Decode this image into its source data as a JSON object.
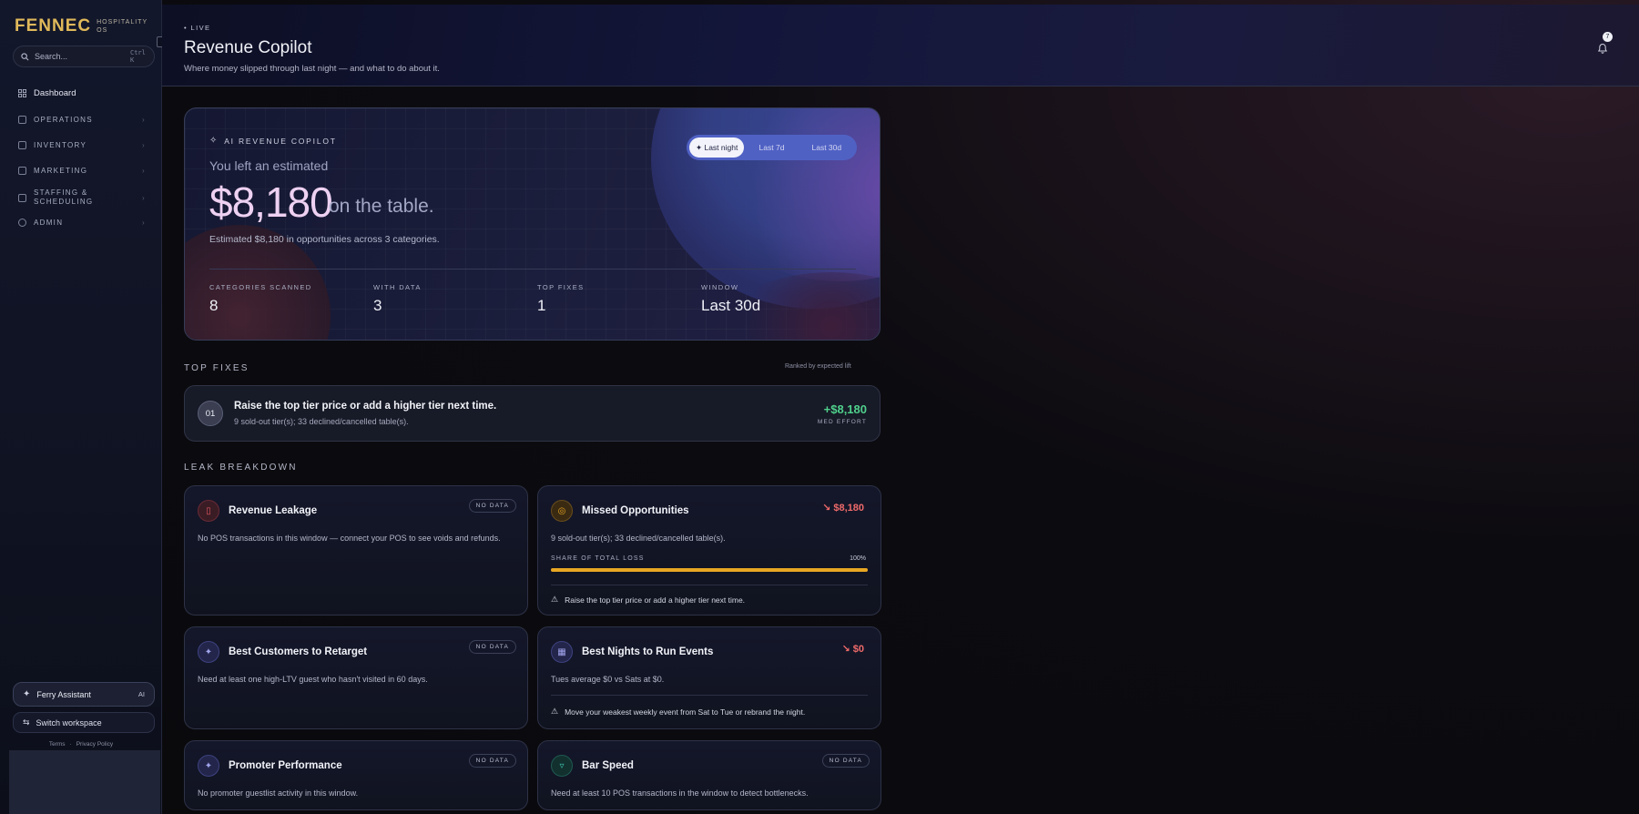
{
  "sidebar": {
    "logo": "FENNEC",
    "logo_sub_1": "HOSPITALITY",
    "logo_sub_2": "OS",
    "search_placeholder": "Search...",
    "search_shortcut": "Ctrl K",
    "items": [
      {
        "label": "Dashboard"
      },
      {
        "label": "OPERATIONS"
      },
      {
        "label": "INVENTORY"
      },
      {
        "label": "MARKETING"
      },
      {
        "label": "STAFFING & SCHEDULING"
      },
      {
        "label": "ADMIN"
      }
    ],
    "assistant_label": "Ferry Assistant",
    "assistant_tag": "AI",
    "switch_label": "Switch workspace",
    "terms": "Terms",
    "privacy": "Privacy Policy"
  },
  "header": {
    "live": "LIVE",
    "title": "Revenue Copilot",
    "subtitle": "Where money slipped through last night — and what to do about it.",
    "notifications": "7"
  },
  "hero": {
    "tag": "AI REVENUE COPILOT",
    "intro": "You left an estimated",
    "amount": "$8,180",
    "on_table": "on the table.",
    "description": "Estimated $8,180 in opportunities across 3 categories.",
    "tabs": [
      {
        "label": "Last night",
        "active": true
      },
      {
        "label": "Last 7d",
        "active": false
      },
      {
        "label": "Last 30d",
        "active": false
      }
    ],
    "stats": [
      {
        "label": "CATEGORIES SCANNED",
        "value": "8"
      },
      {
        "label": "WITH DATA",
        "value": "3"
      },
      {
        "label": "TOP FIXES",
        "value": "1"
      },
      {
        "label": "WINDOW",
        "value": "Last 30d"
      }
    ]
  },
  "top_fixes": {
    "label": "TOP FIXES",
    "ranked": "Ranked by expected lift",
    "items": [
      {
        "num": "01",
        "title": "Raise the top tier price or add a higher tier next time.",
        "sub": "9 sold-out tier(s); 33 declined/cancelled table(s).",
        "amount": "+$8,180",
        "effort": "MED EFFORT"
      }
    ]
  },
  "leak": {
    "label": "LEAK BREAKDOWN",
    "cards": [
      {
        "title": "Revenue Leakage",
        "badge": "NO DATA",
        "desc": "No POS transactions in this window — connect your POS to see voids and refunds.",
        "icon": "receipt-icon",
        "color": "#e0565f"
      },
      {
        "title": "Missed Opportunities",
        "loss": "$8,180",
        "desc": "9 sold-out tier(s); 33 declined/cancelled table(s).",
        "share_label": "SHARE OF TOTAL LOSS",
        "share_value": "100%",
        "share": 1.0,
        "hint": "Raise the top tier price or add a higher tier next time.",
        "icon": "target-icon",
        "color": "#e8a622"
      },
      {
        "title": "Best Customers to Retarget",
        "badge": "NO DATA",
        "desc": "Need at least one high-LTV guest who hasn't visited in 60 days.",
        "icon": "sparkle-icon",
        "color": "#8a8fe0"
      },
      {
        "title": "Best Nights to Run Events",
        "loss": "$0",
        "desc": "Tues average $0 vs Sats at $0.",
        "hint": "Move your weakest weekly event from Sat to Tue or rebrand the night.",
        "icon": "calendar-icon",
        "color": "#8a8fe0"
      },
      {
        "title": "Promoter Performance",
        "badge": "NO DATA",
        "desc": "No promoter guestlist activity in this window.",
        "icon": "sparkle-icon",
        "color": "#8a8fe0"
      },
      {
        "title": "Bar Speed",
        "badge": "NO DATA",
        "desc": "Need at least 10 POS transactions in the window to detect bottlenecks.",
        "icon": "glass-icon",
        "color": "#3cc4b0"
      }
    ]
  }
}
